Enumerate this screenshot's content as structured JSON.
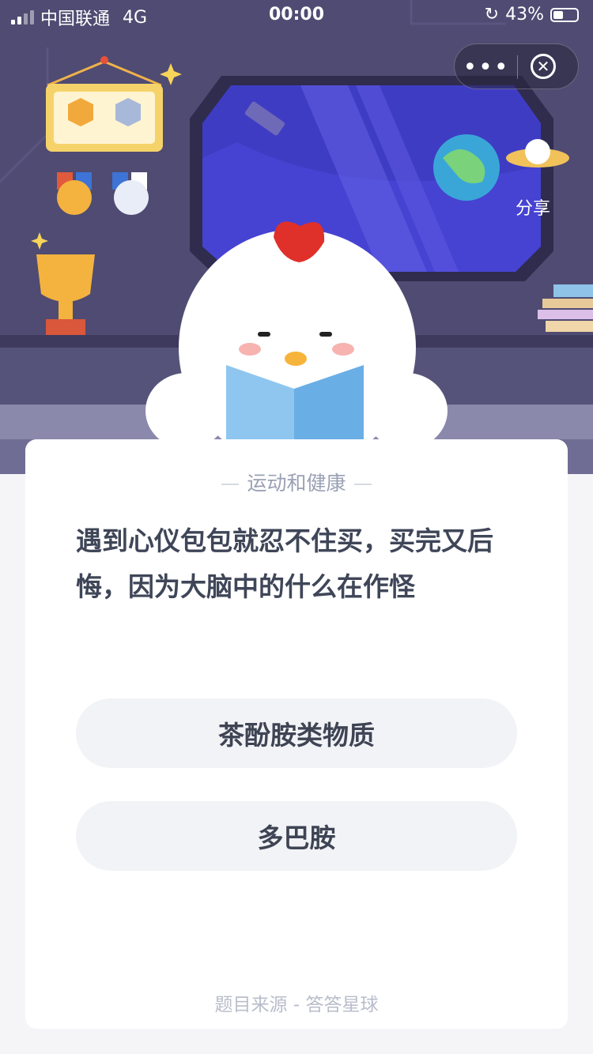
{
  "status_bar": {
    "carrier": "中国联通",
    "network": "4G",
    "time": "00:00",
    "battery": "43%",
    "battery_level": 0.43
  },
  "capsule": {
    "more_icon": "ellipsis-icon",
    "close_icon": "close-circle-icon"
  },
  "header": {
    "share_label": "分享"
  },
  "quiz": {
    "category": "运动和健康",
    "question": "遇到心仪包包就忍不住买，买完又后悔，因为大脑中的什么在作怪",
    "options": [
      {
        "label": "茶酚胺类物质"
      },
      {
        "label": "多巴胺"
      }
    ],
    "source": "题目来源 - 答答星球"
  },
  "colors": {
    "scene_bg": "#4f4b72",
    "card_bg": "#ffffff",
    "option_bg": "#f2f3f6",
    "text_primary": "#3f4658",
    "text_muted": "#9aa0b4"
  }
}
